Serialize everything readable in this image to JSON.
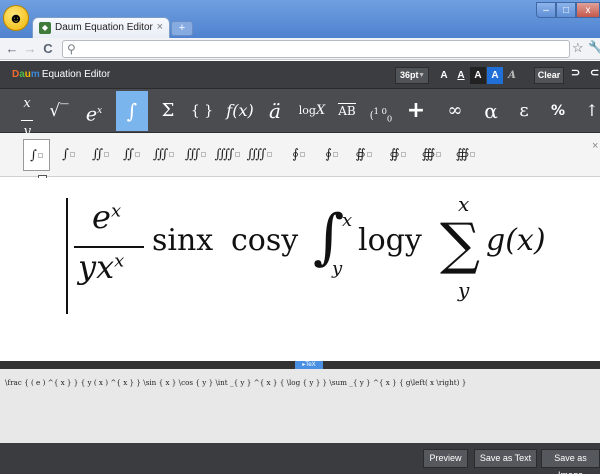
{
  "browser": {
    "tab_title": "Daum Equation Editor",
    "tab_close": "×",
    "new_tab": "+",
    "nav_back": "←",
    "nav_forward": "→",
    "nav_reload": "C",
    "omnibox_icon": "search-icon"
  },
  "app": {
    "logo_letters": [
      "D",
      "a",
      "u",
      "m"
    ],
    "title": "Equation Editor",
    "font_size": "36pt",
    "style_buttons": [
      "A",
      "A",
      "A",
      "A",
      "A"
    ],
    "clear_label": "Clear",
    "undo_glyph": "⊃",
    "redo_glyph": "⊂"
  },
  "symbols": [
    {
      "glyph": "x/y",
      "name": "fraction"
    },
    {
      "glyph": "√‾",
      "name": "root"
    },
    {
      "glyph": "eˣ",
      "name": "superscript"
    },
    {
      "glyph": "∫",
      "name": "integral"
    },
    {
      "glyph": "Σ",
      "name": "sum"
    },
    {
      "glyph": "{ }",
      "name": "brackets"
    },
    {
      "glyph": "f(x)",
      "name": "function"
    },
    {
      "glyph": "ä",
      "name": "accent"
    },
    {
      "glyph": "logX",
      "name": "log"
    },
    {
      "glyph": "AB",
      "name": "overline"
    },
    {
      "glyph": "(1 0 / 0 1)",
      "name": "matrix"
    },
    {
      "glyph": "+",
      "name": "operators"
    },
    {
      "glyph": "∞",
      "name": "infinity"
    },
    {
      "glyph": "α",
      "name": "greek-lower"
    },
    {
      "glyph": "ε",
      "name": "greek-variant"
    },
    {
      "glyph": "%",
      "name": "percent"
    },
    {
      "glyph": "↑",
      "name": "arrows"
    }
  ],
  "palette": [
    "∫",
    "∫",
    "∬",
    "∬",
    "∭",
    "∭",
    "⨌",
    "⨌",
    "∮",
    "∮",
    "∯",
    "∯",
    "∰",
    "∰"
  ],
  "palette_close": "×",
  "equation": {
    "num": "e",
    "num_sup": "x",
    "den": "yx",
    "den_sup": "x",
    "sin": "sinx",
    "cos": "cosy",
    "int_sign": "∫",
    "int_upper": "x",
    "int_lower": "y",
    "log": "logy",
    "sum_sign": "∑",
    "sum_upper": "x",
    "sum_lower": "y",
    "func": "g(x)"
  },
  "tex": {
    "label": "TeX",
    "source": "\\frac { ( e ) ^{ x } } { y ( x ) ^{ x } } \\sin { x } \\cos { y } \\int _{ y } ^{ x } { \\log { y } } \\sum _{ y } ^{ x } { g\\left( x \\right) }"
  },
  "footer": {
    "preview": "Preview",
    "save_text": "Save as Text",
    "save_image": "Save as Image"
  },
  "colors": {
    "accent": "#7ab5ee",
    "toolbar": "#4a4c50",
    "header": "#3b3d40",
    "highlight": "#1f6fd6"
  }
}
